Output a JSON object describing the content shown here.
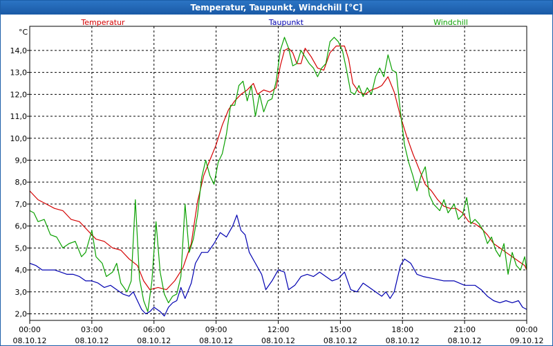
{
  "window": {
    "title": "Temperatur, Taupunkt, Windchill [°C]"
  },
  "chart_data": {
    "type": "line",
    "title": "Temperatur, Taupunkt, Windchill [°C]",
    "y_unit": "°C",
    "ylim": [
      1.7,
      15.1
    ],
    "y_ticks": [
      "2,0",
      "3,0",
      "4,0",
      "5,0",
      "6,0",
      "7,0",
      "8,0",
      "9,0",
      "10,0",
      "11,0",
      "12,0",
      "13,0",
      "14,0"
    ],
    "y_tick_values": [
      2,
      3,
      4,
      5,
      6,
      7,
      8,
      9,
      10,
      11,
      12,
      13,
      14
    ],
    "x_range_hours": [
      0,
      24
    ],
    "x_ticks": [
      {
        "time": "00:00",
        "date": "08.10.12",
        "h": 0
      },
      {
        "time": "03:00",
        "date": "08.10.12",
        "h": 3
      },
      {
        "time": "06:00",
        "date": "08.10.12",
        "h": 6
      },
      {
        "time": "09:00",
        "date": "08.10.12",
        "h": 9
      },
      {
        "time": "12:00",
        "date": "08.10.12",
        "h": 12
      },
      {
        "time": "15:00",
        "date": "08.10.12",
        "h": 15
      },
      {
        "time": "18:00",
        "date": "08.10.12",
        "h": 18
      },
      {
        "time": "21:00",
        "date": "08.10.12",
        "h": 21
      },
      {
        "time": "00:00",
        "date": "09.10.12",
        "h": 24
      }
    ],
    "grid": true,
    "legend": "top",
    "series": [
      {
        "name": "Temperatur",
        "color": "#d40000",
        "points": [
          [
            0,
            7.6
          ],
          [
            0.4,
            7.2
          ],
          [
            0.8,
            7.0
          ],
          [
            1.2,
            6.8
          ],
          [
            1.6,
            6.7
          ],
          [
            2.0,
            6.3
          ],
          [
            2.4,
            6.2
          ],
          [
            2.8,
            5.8
          ],
          [
            3.2,
            5.4
          ],
          [
            3.6,
            5.3
          ],
          [
            4.0,
            5.0
          ],
          [
            4.4,
            4.9
          ],
          [
            4.8,
            4.5
          ],
          [
            5.2,
            4.2
          ],
          [
            5.5,
            3.5
          ],
          [
            5.8,
            3.1
          ],
          [
            6.2,
            3.2
          ],
          [
            6.6,
            3.1
          ],
          [
            7.0,
            3.5
          ],
          [
            7.4,
            4.1
          ],
          [
            7.8,
            5.2
          ],
          [
            8.1,
            7.1
          ],
          [
            8.4,
            8.3
          ],
          [
            8.7,
            9.0
          ],
          [
            9.0,
            9.7
          ],
          [
            9.3,
            10.6
          ],
          [
            9.6,
            11.3
          ],
          [
            9.9,
            11.7
          ],
          [
            10.2,
            12.0
          ],
          [
            10.5,
            12.2
          ],
          [
            10.8,
            12.5
          ],
          [
            11.0,
            12.0
          ],
          [
            11.3,
            12.2
          ],
          [
            11.6,
            12.1
          ],
          [
            11.9,
            12.3
          ],
          [
            12.1,
            13.3
          ],
          [
            12.3,
            14.0
          ],
          [
            12.5,
            14.1
          ],
          [
            12.7,
            13.9
          ],
          [
            12.9,
            13.4
          ],
          [
            13.1,
            13.4
          ],
          [
            13.3,
            14.1
          ],
          [
            13.6,
            13.7
          ],
          [
            13.9,
            13.2
          ],
          [
            14.2,
            13.1
          ],
          [
            14.5,
            13.9
          ],
          [
            14.8,
            14.2
          ],
          [
            15.0,
            14.2
          ],
          [
            15.2,
            14.2
          ],
          [
            15.4,
            13.6
          ],
          [
            15.6,
            12.5
          ],
          [
            15.9,
            12.1
          ],
          [
            16.2,
            12.0
          ],
          [
            16.5,
            12.2
          ],
          [
            16.8,
            12.3
          ],
          [
            17.0,
            12.4
          ],
          [
            17.3,
            12.8
          ],
          [
            17.6,
            12.1
          ],
          [
            17.9,
            11.0
          ],
          [
            18.2,
            10.1
          ],
          [
            18.5,
            9.3
          ],
          [
            18.8,
            8.6
          ],
          [
            19.1,
            7.9
          ],
          [
            19.4,
            7.6
          ],
          [
            19.7,
            7.2
          ],
          [
            20.0,
            6.9
          ],
          [
            20.3,
            6.8
          ],
          [
            20.6,
            6.8
          ],
          [
            20.9,
            6.6
          ],
          [
            21.2,
            6.2
          ],
          [
            21.5,
            6.1
          ],
          [
            21.8,
            5.9
          ],
          [
            22.1,
            5.6
          ],
          [
            22.4,
            5.2
          ],
          [
            22.7,
            5.0
          ],
          [
            23.0,
            4.8
          ],
          [
            23.3,
            4.6
          ],
          [
            23.6,
            4.4
          ],
          [
            23.9,
            4.2
          ],
          [
            24,
            4.0
          ]
        ]
      },
      {
        "name": "Taupunkt",
        "color": "#0000b0",
        "points": [
          [
            0,
            4.3
          ],
          [
            0.3,
            4.2
          ],
          [
            0.6,
            4.0
          ],
          [
            0.9,
            4.0
          ],
          [
            1.2,
            4.0
          ],
          [
            1.5,
            3.9
          ],
          [
            1.8,
            3.8
          ],
          [
            2.1,
            3.8
          ],
          [
            2.4,
            3.7
          ],
          [
            2.7,
            3.5
          ],
          [
            3.0,
            3.5
          ],
          [
            3.3,
            3.4
          ],
          [
            3.6,
            3.2
          ],
          [
            3.9,
            3.3
          ],
          [
            4.2,
            3.1
          ],
          [
            4.5,
            2.9
          ],
          [
            4.8,
            2.8
          ],
          [
            5.0,
            3.0
          ],
          [
            5.2,
            2.6
          ],
          [
            5.4,
            2.2
          ],
          [
            5.6,
            2.0
          ],
          [
            5.8,
            2.1
          ],
          [
            6.0,
            2.3
          ],
          [
            6.3,
            2.1
          ],
          [
            6.5,
            1.9
          ],
          [
            6.7,
            2.3
          ],
          [
            6.9,
            2.5
          ],
          [
            7.1,
            2.6
          ],
          [
            7.3,
            3.2
          ],
          [
            7.5,
            2.7
          ],
          [
            7.8,
            3.4
          ],
          [
            8.0,
            4.3
          ],
          [
            8.3,
            4.8
          ],
          [
            8.6,
            4.8
          ],
          [
            8.9,
            5.2
          ],
          [
            9.2,
            5.7
          ],
          [
            9.5,
            5.5
          ],
          [
            9.8,
            6.0
          ],
          [
            10.0,
            6.5
          ],
          [
            10.2,
            5.8
          ],
          [
            10.4,
            5.6
          ],
          [
            10.6,
            4.8
          ],
          [
            10.9,
            4.3
          ],
          [
            11.2,
            3.8
          ],
          [
            11.4,
            3.1
          ],
          [
            11.7,
            3.5
          ],
          [
            12.0,
            4.0
          ],
          [
            12.3,
            3.9
          ],
          [
            12.5,
            3.1
          ],
          [
            12.8,
            3.3
          ],
          [
            13.1,
            3.7
          ],
          [
            13.4,
            3.8
          ],
          [
            13.7,
            3.7
          ],
          [
            14.0,
            3.9
          ],
          [
            14.3,
            3.7
          ],
          [
            14.6,
            3.5
          ],
          [
            14.9,
            3.6
          ],
          [
            15.2,
            3.9
          ],
          [
            15.5,
            3.1
          ],
          [
            15.8,
            3.0
          ],
          [
            16.1,
            3.4
          ],
          [
            16.4,
            3.2
          ],
          [
            16.7,
            3.0
          ],
          [
            17.0,
            2.8
          ],
          [
            17.2,
            3.0
          ],
          [
            17.4,
            2.7
          ],
          [
            17.6,
            3.0
          ],
          [
            17.9,
            4.2
          ],
          [
            18.1,
            4.5
          ],
          [
            18.4,
            4.3
          ],
          [
            18.7,
            3.8
          ],
          [
            19.0,
            3.7
          ],
          [
            19.5,
            3.6
          ],
          [
            20.0,
            3.5
          ],
          [
            20.5,
            3.5
          ],
          [
            21.0,
            3.3
          ],
          [
            21.5,
            3.3
          ],
          [
            21.8,
            3.1
          ],
          [
            22.1,
            2.8
          ],
          [
            22.4,
            2.6
          ],
          [
            22.7,
            2.5
          ],
          [
            23.0,
            2.6
          ],
          [
            23.3,
            2.5
          ],
          [
            23.6,
            2.6
          ],
          [
            23.8,
            2.3
          ],
          [
            24,
            2.2
          ]
        ]
      },
      {
        "name": "Windchill",
        "color": "#0aa000",
        "points": [
          [
            0,
            6.7
          ],
          [
            0.2,
            6.6
          ],
          [
            0.4,
            6.2
          ],
          [
            0.7,
            6.3
          ],
          [
            1.0,
            5.6
          ],
          [
            1.3,
            5.5
          ],
          [
            1.6,
            5.0
          ],
          [
            1.9,
            5.2
          ],
          [
            2.2,
            5.3
          ],
          [
            2.5,
            4.6
          ],
          [
            2.7,
            4.8
          ],
          [
            3.0,
            5.8
          ],
          [
            3.2,
            4.6
          ],
          [
            3.5,
            4.3
          ],
          [
            3.7,
            3.7
          ],
          [
            4.0,
            3.9
          ],
          [
            4.2,
            4.3
          ],
          [
            4.4,
            3.4
          ],
          [
            4.7,
            3.0
          ],
          [
            4.9,
            3.5
          ],
          [
            5.1,
            7.2
          ],
          [
            5.3,
            3.6
          ],
          [
            5.5,
            2.6
          ],
          [
            5.7,
            2.1
          ],
          [
            5.9,
            3.5
          ],
          [
            6.1,
            6.2
          ],
          [
            6.3,
            3.9
          ],
          [
            6.5,
            2.9
          ],
          [
            6.7,
            2.5
          ],
          [
            6.9,
            2.8
          ],
          [
            7.1,
            2.9
          ],
          [
            7.3,
            3.7
          ],
          [
            7.5,
            7.0
          ],
          [
            7.7,
            4.8
          ],
          [
            7.9,
            5.4
          ],
          [
            8.1,
            6.5
          ],
          [
            8.3,
            8.2
          ],
          [
            8.5,
            9.0
          ],
          [
            8.7,
            8.3
          ],
          [
            8.9,
            7.9
          ],
          [
            9.1,
            8.9
          ],
          [
            9.3,
            9.3
          ],
          [
            9.5,
            10.2
          ],
          [
            9.7,
            11.5
          ],
          [
            9.9,
            11.5
          ],
          [
            10.1,
            12.4
          ],
          [
            10.3,
            12.6
          ],
          [
            10.5,
            11.7
          ],
          [
            10.7,
            12.4
          ],
          [
            10.9,
            11.0
          ],
          [
            11.1,
            12.0
          ],
          [
            11.3,
            11.2
          ],
          [
            11.5,
            11.7
          ],
          [
            11.7,
            11.8
          ],
          [
            11.9,
            12.6
          ],
          [
            12.1,
            14.0
          ],
          [
            12.3,
            14.6
          ],
          [
            12.5,
            14.1
          ],
          [
            12.7,
            13.3
          ],
          [
            12.9,
            13.4
          ],
          [
            13.1,
            14.0
          ],
          [
            13.3,
            13.7
          ],
          [
            13.5,
            13.4
          ],
          [
            13.7,
            13.2
          ],
          [
            13.9,
            12.8
          ],
          [
            14.1,
            13.2
          ],
          [
            14.3,
            13.4
          ],
          [
            14.5,
            14.4
          ],
          [
            14.7,
            14.6
          ],
          [
            14.9,
            14.4
          ],
          [
            15.1,
            14.0
          ],
          [
            15.3,
            13.1
          ],
          [
            15.5,
            12.1
          ],
          [
            15.7,
            12.0
          ],
          [
            15.9,
            12.4
          ],
          [
            16.1,
            11.9
          ],
          [
            16.3,
            12.3
          ],
          [
            16.5,
            12.0
          ],
          [
            16.7,
            12.8
          ],
          [
            16.9,
            13.2
          ],
          [
            17.1,
            12.8
          ],
          [
            17.3,
            13.8
          ],
          [
            17.5,
            13.1
          ],
          [
            17.7,
            13.0
          ],
          [
            17.9,
            11.2
          ],
          [
            18.1,
            9.7
          ],
          [
            18.3,
            8.9
          ],
          [
            18.5,
            8.3
          ],
          [
            18.7,
            7.6
          ],
          [
            18.9,
            8.3
          ],
          [
            19.1,
            8.7
          ],
          [
            19.3,
            7.4
          ],
          [
            19.5,
            7.0
          ],
          [
            19.8,
            6.7
          ],
          [
            20.0,
            7.2
          ],
          [
            20.2,
            6.6
          ],
          [
            20.5,
            7.0
          ],
          [
            20.7,
            6.3
          ],
          [
            20.9,
            6.5
          ],
          [
            21.1,
            7.3
          ],
          [
            21.3,
            6.1
          ],
          [
            21.5,
            6.3
          ],
          [
            21.7,
            6.1
          ],
          [
            21.9,
            5.8
          ],
          [
            22.1,
            5.2
          ],
          [
            22.3,
            5.5
          ],
          [
            22.5,
            4.9
          ],
          [
            22.7,
            4.6
          ],
          [
            22.9,
            5.2
          ],
          [
            23.1,
            3.8
          ],
          [
            23.3,
            4.8
          ],
          [
            23.5,
            4.2
          ],
          [
            23.7,
            4.0
          ],
          [
            23.9,
            4.6
          ],
          [
            24,
            4.0
          ]
        ]
      }
    ]
  }
}
